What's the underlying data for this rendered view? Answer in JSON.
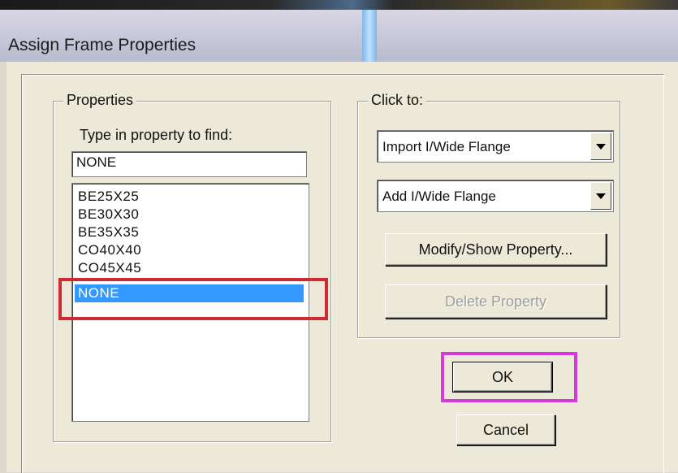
{
  "window": {
    "title": "Assign Frame Properties"
  },
  "properties_group": {
    "legend": "Properties",
    "find_label": "Type in property to find:",
    "find_value": "NONE",
    "items": [
      "BE25X25",
      "BE30X30",
      "BE35X35",
      "CO40X40",
      "CO45X45",
      "NONE"
    ],
    "selected": "NONE"
  },
  "click_to_group": {
    "legend": "Click to:",
    "import_combo": {
      "value": "Import I/Wide Flange",
      "icon": "chevron-down-icon"
    },
    "add_combo": {
      "value": "Add I/Wide Flange",
      "icon": "chevron-down-icon"
    },
    "modify_button": "Modify/Show Property...",
    "delete_button": "Delete Property"
  },
  "buttons": {
    "ok": "OK",
    "cancel": "Cancel"
  },
  "annotations": {
    "red_box_color": "#cc2b35",
    "magenta_box_color": "#d43ad8"
  }
}
